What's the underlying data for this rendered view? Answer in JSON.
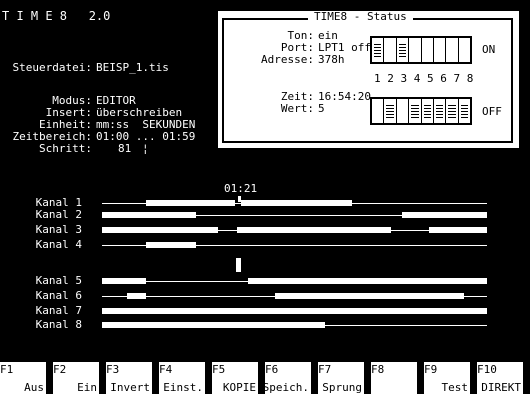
{
  "app": {
    "title": "T I M E 8   2.0"
  },
  "info": {
    "steuerdatei_label": "Steuerdatei:",
    "steuerdatei_value": "BEISP_1.tis",
    "modus_label": "Modus:",
    "modus_value": "EDITOR",
    "insert_label": "Insert:",
    "insert_value": "überschreiben",
    "einheit_label": "Einheit:",
    "einheit_value": "mm:ss  SEKUNDEN",
    "zeitbereich_label": "Zeitbereich:",
    "zeitbereich_value": "01:00 ... 01:59",
    "schritt_label": "Schritt:",
    "schritt_value": "81",
    "schritt_cursor": "¦"
  },
  "status": {
    "title": "TIME8 - Status",
    "ton_label": "Ton:",
    "ton_value": "ein",
    "port_label": "Port:",
    "port_value": "LPT1 off",
    "adresse_label": "Adresse:",
    "adresse_value": "378h",
    "zeit_label": "Zeit:",
    "zeit_value": "16:54:20",
    "wert_label": "Wert:",
    "wert_value": "5",
    "on_label": "ON",
    "off_label": "OFF",
    "switch_numbers": "1 2 3 4 5 6 7 8",
    "on_switches": [
      1,
      0,
      1,
      0,
      0,
      0,
      0,
      0
    ],
    "off_switches": [
      0,
      1,
      0,
      1,
      1,
      1,
      1,
      1
    ]
  },
  "timeline": {
    "cursor_time": "01:21",
    "channels": [
      {
        "label": "Kanal 1",
        "segments": [
          [
            0.115,
            0.345
          ],
          [
            0.36,
            0.65
          ]
        ]
      },
      {
        "label": "Kanal 2",
        "segments": [
          [
            0.0,
            0.245
          ],
          [
            0.78,
            1.0
          ]
        ]
      },
      {
        "label": "Kanal 3",
        "segments": [
          [
            0.0,
            0.3
          ],
          [
            0.35,
            0.75
          ],
          [
            0.85,
            1.0
          ]
        ]
      },
      {
        "label": "Kanal 4",
        "segments": [
          [
            0.115,
            0.245
          ]
        ]
      },
      {
        "label": "Kanal 5",
        "segments": [
          [
            0.0,
            0.115
          ],
          [
            0.38,
            1.0
          ]
        ]
      },
      {
        "label": "Kanal 6",
        "segments": [
          [
            0.065,
            0.115
          ],
          [
            0.45,
            0.94
          ]
        ]
      },
      {
        "label": "Kanal 7",
        "segments": [
          [
            0.0,
            1.0
          ]
        ]
      },
      {
        "label": "Kanal 8",
        "segments": [
          [
            0.0,
            0.58
          ]
        ]
      }
    ]
  },
  "fkeys": [
    {
      "key": "F1",
      "label": "Aus"
    },
    {
      "key": "F2",
      "label": "Ein"
    },
    {
      "key": "F3",
      "label": "Invert"
    },
    {
      "key": "F4",
      "label": "Einst."
    },
    {
      "key": "F5",
      "label": "KOPIE"
    },
    {
      "key": "F6",
      "label": "Speich."
    },
    {
      "key": "F7",
      "label": "Sprung"
    },
    {
      "key": "F8",
      "label": ""
    },
    {
      "key": "F9",
      "label": "Test"
    },
    {
      "key": "F10",
      "label": "DIREKT"
    }
  ]
}
